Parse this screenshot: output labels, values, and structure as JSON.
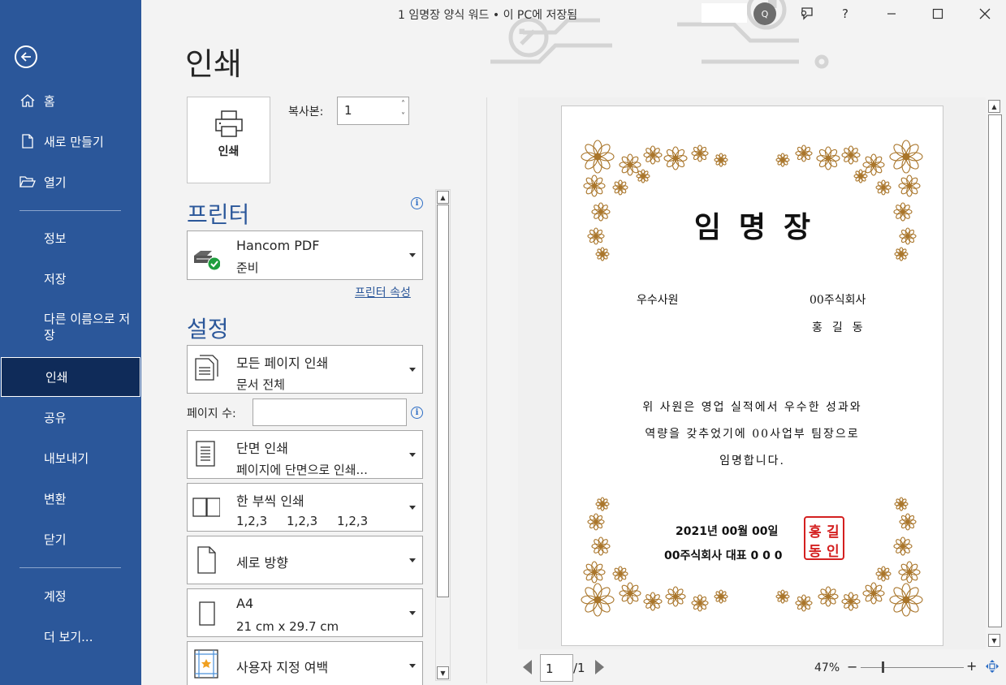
{
  "window": {
    "title": "1 임명장 양식 워드 • 이 PC에 저장됨",
    "avatar_initial": "Q",
    "help_label": "?"
  },
  "sidebar": {
    "items": [
      {
        "label": "홈",
        "icon": "home-icon"
      },
      {
        "label": "새로 만들기",
        "icon": "new-document-icon"
      },
      {
        "label": "열기",
        "icon": "open-folder-icon"
      },
      {
        "label": "정보"
      },
      {
        "label": "저장"
      },
      {
        "label": "다른 이름으로 저장"
      },
      {
        "label": "인쇄",
        "active": true
      },
      {
        "label": "공유"
      },
      {
        "label": "내보내기"
      },
      {
        "label": "변환"
      },
      {
        "label": "닫기"
      },
      {
        "label": "계정"
      },
      {
        "label": "더 보기..."
      }
    ]
  },
  "print": {
    "heading": "인쇄",
    "print_button_label": "인쇄",
    "copies_label": "복사본:",
    "copies_value": "1",
    "printer_heading": "프린터",
    "printer": {
      "name": "Hancom PDF",
      "status": "준비"
    },
    "printer_properties": "프린터 속성",
    "settings_heading": "설정",
    "pages_label": "페이지 수:",
    "pages_value": "",
    "settings": [
      {
        "line1": "모든 페이지 인쇄",
        "line2": "문서 전체"
      },
      {
        "line1": "단면 인쇄",
        "line2": "페이지에 단면으로 인쇄..."
      },
      {
        "line1": "한 부씩 인쇄",
        "line2": "1,2,3     1,2,3     1,2,3"
      },
      {
        "line1": "세로 방향"
      },
      {
        "line1": "A4",
        "line2": "21 cm x 29.7 cm"
      },
      {
        "line1": "사용자 지정 여백"
      }
    ]
  },
  "preview": {
    "title": "임명장",
    "award_type": "우수사원",
    "company": "00주식회사",
    "recipient": "홍길동",
    "body": [
      "위 사원은 영업 실적에서 우수한 성과와",
      "역량을 갖추었기에 00사업부 팀장으로",
      "임명합니다."
    ],
    "date": "2021년 00월 00일",
    "signer": "00주식회사 대표 0 0 0",
    "seal_chars": [
      "홍",
      "길",
      "동",
      "인"
    ],
    "accent_color": "#a9752a",
    "seal_color": "#d42020"
  },
  "navigation": {
    "current_page": "1",
    "total_pages": "/1",
    "zoom": "47%",
    "zoom_minus": "−",
    "zoom_plus": "+",
    "zoom_fraction": 0.2
  }
}
